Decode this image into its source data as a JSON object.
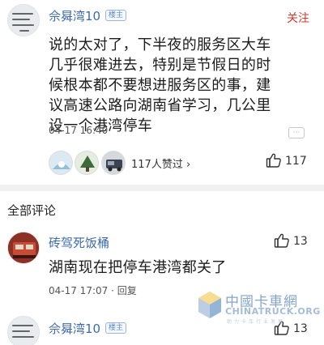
{
  "comment1": {
    "username": "佘曻湾10",
    "badge": "楼主",
    "follow_label": "关注",
    "text": "说的太对了，下半夜的服务区大车几乎很难进去，特别是节假日的时候根本都不要想进服务区的事，建议高速公路向湖南省学习，几公里设一个港湾停车",
    "time": "04-17 16:40",
    "likes_summary": "117人赞过 ›",
    "like_count": "117"
  },
  "section_title": "全部评论",
  "comment2": {
    "username": "砖驾死饭桶",
    "text": "湖南现在把停车港湾都关了",
    "time": "04-17 17:07 · 回复",
    "like_count": "13"
  },
  "comment3": {
    "username": "佘曻湾10",
    "badge": "楼主",
    "like_count": "13"
  },
  "watermark": {
    "title": "中國卡車網",
    "subtitle": "CHINATRUCK.ORG",
    "tagline": "助力卡车行业发展"
  },
  "colors": {
    "username_blue": "#3b6ab0",
    "follow_red": "#d23a2c",
    "watermark_blue": "#7fa1c9"
  }
}
